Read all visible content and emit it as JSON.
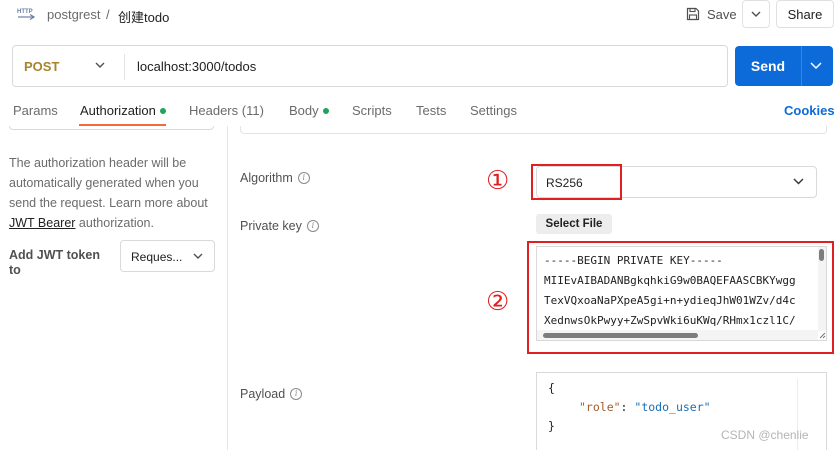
{
  "header": {
    "breadcrumb_parent": "postgrest",
    "breadcrumb_sep": "/",
    "breadcrumb_current": "创建todo",
    "save_label": "Save",
    "share_label": "Share"
  },
  "request": {
    "method": "POST",
    "url": "localhost:3000/todos",
    "send_label": "Send",
    "method_color": "#a8842a",
    "send_color": "#0d6ad9"
  },
  "tabs": [
    {
      "label": "Params"
    },
    {
      "label": "Authorization",
      "dot": true,
      "active": true
    },
    {
      "label": "Headers (11)"
    },
    {
      "label": "Body",
      "dot": true
    },
    {
      "label": "Scripts"
    },
    {
      "label": "Tests"
    },
    {
      "label": "Settings"
    }
  ],
  "cookies_label": "Cookies",
  "auth": {
    "desc_1": "The authorization header will be automatically generated when you send the request. Learn more about ",
    "desc_link": "JWT Bearer",
    "desc_2": " authorization.",
    "add_token_label": "Add JWT token to",
    "add_token_value": "Reques..."
  },
  "form": {
    "algorithm_label": "Algorithm",
    "algorithm_value": "RS256",
    "private_key_label": "Private key",
    "select_file_label": "Select File",
    "private_key_lines": [
      "-----BEGIN PRIVATE KEY-----",
      "MIIEvAIBADANBgkqhkiG9w0BAQEFAASCBKYwgg",
      "TexVQxoaNaPXpeA5gi+n+ydieqJhW01WZv/d4c",
      "XednwsOkPwyy+ZwSpvWki6uKWq/RHmx1czl1C/"
    ],
    "payload_label": "Payload",
    "payload_open": "{",
    "payload_key": "\"role\"",
    "payload_colon": ": ",
    "payload_value": "\"todo_user\"",
    "payload_close": "}"
  },
  "annotations": {
    "marker_1": "①",
    "marker_2": "②",
    "color": "#e02020"
  },
  "watermark": "CSDN @chenlie"
}
